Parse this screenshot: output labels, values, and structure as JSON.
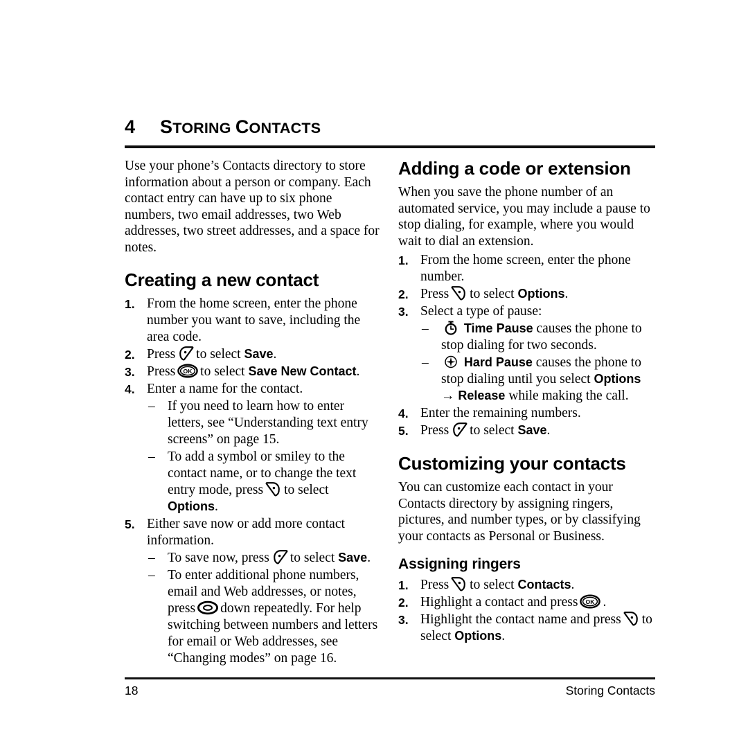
{
  "chapter": {
    "number": "4",
    "title": "Storing Contacts",
    "title_first": "S",
    "title_rest": "TORING ",
    "title_second_first": "C",
    "title_second_rest": "ONTACTS"
  },
  "left_column": {
    "intro": "Use your phone’s Contacts directory to store information about a person or company. Each contact entry can have up to six phone numbers, two email addresses, two Web addresses, two street addresses, and a space for notes.",
    "heading": "Creating a new contact",
    "steps": [
      {
        "marker": "1.",
        "text": "From the home screen, enter the phone number you want to save, including the area code."
      },
      {
        "marker": "2.",
        "pre": "Press",
        "icon": "left-softkey-icon",
        "mid": "to select",
        "bold": "Save",
        "post": "."
      },
      {
        "marker": "3.",
        "pre": "Press",
        "icon": "ok-key-icon",
        "mid": "to select",
        "bold": "Save New Contact",
        "post": "."
      },
      {
        "marker": "4.",
        "text": "Enter a name for the contact.",
        "subitems": [
          {
            "dash": "–",
            "text": "If you need to learn how to enter letters, see “Understanding text entry screens” on page 15."
          },
          {
            "dash": "–",
            "pre": "To add a symbol or smiley to the contact name, or to change the text entry mode, press",
            "icon": "right-softkey-icon",
            "mid": "to select",
            "bold": "Options",
            "post": "."
          }
        ]
      },
      {
        "marker": "5.",
        "text": "Either save now or add more contact information.",
        "subitems": [
          {
            "dash": "–",
            "pre": "To save now, press",
            "icon": "left-softkey-icon",
            "mid": "to select",
            "bold": "Save",
            "post": "."
          },
          {
            "dash": "–",
            "pre": "To enter additional phone numbers, email and Web addresses, or notes, press",
            "icon": "navigation-key-icon",
            "mid": "down repeatedly. For help switching between numbers and letters for email or Web addresses, see “Changing modes” on page 16.",
            "bold": "",
            "post": ""
          }
        ]
      }
    ]
  },
  "right_column": {
    "heading1": "Adding a code or extension",
    "intro1": "When you save the phone number of an automated service, you may include a pause to stop dialing, for example, where you would wait to dial an extension.",
    "steps1": [
      {
        "marker": "1.",
        "text": "From the home screen, enter the phone number."
      },
      {
        "marker": "2.",
        "pre": "Press",
        "icon": "right-softkey-icon",
        "mid": "to select",
        "bold": "Options",
        "post": "."
      },
      {
        "marker": "3.",
        "text": "Select a type of pause:",
        "subitems": [
          {
            "dash": "–",
            "icon": "stopwatch-icon",
            "bold": "Time Pause",
            "text": "causes the phone to stop dialing for two seconds."
          },
          {
            "dash": "–",
            "icon": "hard-pause-icon",
            "bold": "Hard Pause",
            "text": "causes the phone to stop dialing until you select",
            "bold2": "Options",
            "arrow": "→",
            "bold3": "Release",
            "tail": "while making the call."
          }
        ]
      },
      {
        "marker": "4.",
        "text": "Enter the remaining numbers."
      },
      {
        "marker": "5.",
        "pre": "Press",
        "icon": "left-softkey-icon",
        "mid": "to select",
        "bold": "Save",
        "post": "."
      }
    ],
    "heading2": "Customizing your contacts",
    "intro2": "You can customize each contact in your Contacts directory by assigning ringers, pictures, and number types, or by classifying your contacts as Personal or Business.",
    "heading3": "Assigning ringers",
    "steps2": [
      {
        "marker": "1.",
        "pre": "Press",
        "icon": "right-softkey-icon",
        "mid": "to select",
        "bold": "Contacts",
        "post": "."
      },
      {
        "marker": "2.",
        "pre": "Highlight a contact and press",
        "icon": "ok-key-icon",
        "mid": "",
        "bold": "",
        "post": "."
      },
      {
        "marker": "3.",
        "pre": "Highlight the contact name and press",
        "icon": "right-softkey-icon",
        "mid": "to select",
        "bold": "Options",
        "post": "."
      }
    ]
  },
  "footer": {
    "page_number": "18",
    "section_title": "Storing Contacts"
  },
  "colors": {
    "text": "#000000",
    "rule": "#111111",
    "background": "#ffffff"
  }
}
